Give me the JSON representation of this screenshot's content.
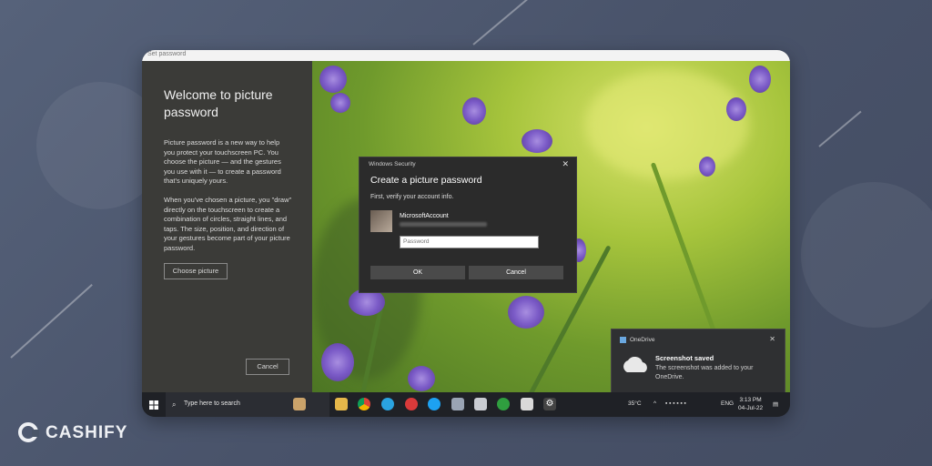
{
  "window": {
    "title": "Set password"
  },
  "left_panel": {
    "title": "Welcome to picture password",
    "paragraph1": "Picture password is a new way to help you protect your touchscreen PC. You choose the picture — and the gestures you use with it — to create a password that's uniquely yours.",
    "paragraph2": "When you've chosen a picture, you \"draw\" directly on the touchscreen to create a combination of circles, straight lines, and taps. The size, position, and direction of your gestures become part of your picture password.",
    "choose_button": "Choose picture",
    "cancel_button": "Cancel"
  },
  "dialog": {
    "header": "Windows Security",
    "close_glyph": "✕",
    "title": "Create a picture password",
    "subtitle": "First, verify your account info.",
    "account_name": "MicrosoftAccount",
    "password_placeholder": "Password",
    "ok_label": "OK",
    "cancel_label": "Cancel"
  },
  "toast": {
    "app": "OneDrive",
    "close_glyph": "✕",
    "title": "Screenshot saved",
    "message": "The screenshot was added to your OneDrive."
  },
  "taskbar": {
    "search_placeholder": "Type here to search",
    "temperature": "35°C",
    "language": "ENG",
    "time": "3:13 PM",
    "date": "04-Jul-22"
  },
  "brand": {
    "name": "CASHIFY"
  }
}
